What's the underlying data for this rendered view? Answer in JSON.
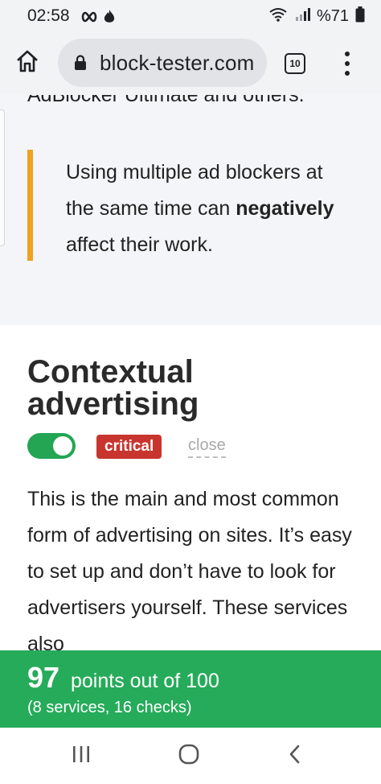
{
  "status_bar": {
    "time": "02:58",
    "battery_text": "%71"
  },
  "browser": {
    "url": "block-tester.com",
    "tab_count": "10"
  },
  "article": {
    "cut_off_line": "AdBlocker Ultimate and others.",
    "callout": {
      "line_start": "Using multiple ad blockers at the same time can",
      "emphasis": "negatively",
      "line_end": " affect their work."
    },
    "section": {
      "title": "Contextual advertising",
      "toggle_on": true,
      "badge": "critical",
      "close_label": "close",
      "paragraph": "This is the main and most common form of advertising on sites. It’s easy to set up and don’t have to look for advertisers yourself. These services also"
    }
  },
  "score": {
    "points": "97",
    "label": "points out of 100",
    "details": "(8 services, 16 checks)"
  },
  "colors": {
    "accent_green": "#26ab5a",
    "toggle_green": "#23a554",
    "critical_red": "#c8352e",
    "callout_orange": "#f0a020"
  },
  "icons": {
    "status_left": [
      "infinity-icon",
      "fire-icon"
    ],
    "status_right": [
      "wifi-icon",
      "signal-icon",
      "battery-icon"
    ],
    "browser": [
      "home-icon",
      "lock-icon",
      "tab-switcher-icon",
      "overflow-menu-icon"
    ],
    "nav": [
      "recent-apps-icon",
      "home-circle-icon",
      "back-icon"
    ]
  }
}
